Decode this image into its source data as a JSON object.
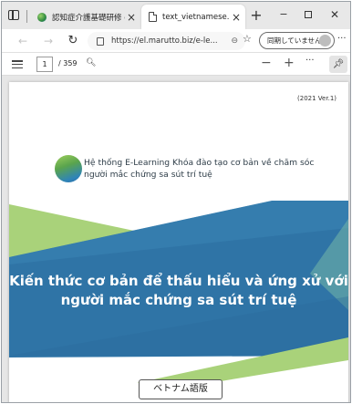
{
  "browser": {
    "tabs": [
      {
        "title": "認知症介護基礎研修 e",
        "close": "×"
      },
      {
        "title": "text_vietnamese.pdf",
        "close": "×"
      }
    ],
    "new_tab": "+",
    "window_controls": {
      "minimize": "−",
      "close": "✕"
    },
    "address": {
      "url": "https://el.marutto.biz/e-le...",
      "sync_label": "同期していません",
      "more": "···"
    }
  },
  "pdf_toolbar": {
    "page_current": "1",
    "page_total": "/ 359",
    "zoom_out": "−",
    "zoom_in": "+",
    "more": "···"
  },
  "document": {
    "version": "(2021 Ver.1)",
    "subtitle": "Hệ thống E-Learning Khóa đào tạo cơ bản về chăm sóc người mắc chứng sa sút trí tuệ",
    "title": "Kiến thức cơ bản để thấu hiểu và ứng xử với người mắc chứng sa sút trí tuệ",
    "language_badge": "ベトナム語版"
  },
  "colors": {
    "banner_blue": "#2f74a6",
    "banner_green": "#a9d27a",
    "text_dark": "#2e3d48"
  },
  "icons": [
    "tab-actions-icon",
    "favicon-icon",
    "pdf-file-icon",
    "back-icon",
    "forward-icon",
    "reload-icon",
    "lock-icon",
    "zoom-icon",
    "favorite-icon",
    "table-of-contents-icon",
    "search-icon",
    "pin-icon"
  ]
}
